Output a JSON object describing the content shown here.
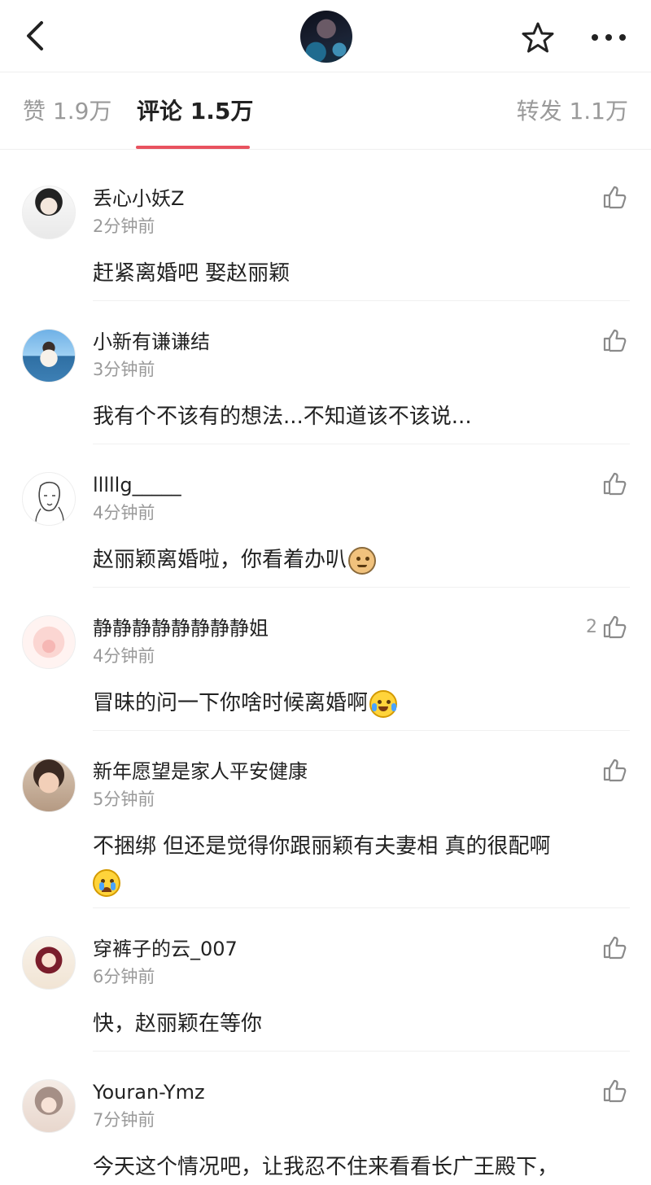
{
  "header": {
    "back_icon": "chevron-left-icon",
    "star_icon": "star-icon",
    "more_icon": "more-dots-icon"
  },
  "tabs": [
    {
      "label": "赞 1.9万"
    },
    {
      "label": "评论 1.5万"
    },
    {
      "label": "转发 1.1万"
    }
  ],
  "colors": {
    "accent": "#e8525f",
    "muted": "#9a9a9a",
    "text": "#222222"
  },
  "comments": [
    {
      "username": "丢心小妖Z",
      "time": "2分钟前",
      "text": "赶紧离婚吧 娶赵丽颖",
      "likes": "",
      "emoji": ""
    },
    {
      "username": "小新有谦谦结",
      "time": "3分钟前",
      "text": "我有个不该有的想法...不知道该不该说...",
      "likes": "",
      "emoji": ""
    },
    {
      "username": "lllllg_____",
      "time": "4分钟前",
      "text": "赵丽颖离婚啦，你看着办叭",
      "likes": "",
      "emoji": "cat-emoji"
    },
    {
      "username": "静静静静静静静静姐",
      "time": "4分钟前",
      "text": "冒昧的问一下你啥时候离婚啊",
      "likes": "2",
      "emoji": "laughing-crying-emoji"
    },
    {
      "username": "新年愿望是家人平安健康",
      "time": "5分钟前",
      "text": "不捆绑 但还是觉得你跟丽颖有夫妻相 真的很配啊",
      "likes": "",
      "emoji": "crying-emoji"
    },
    {
      "username": "穿裤子的云_007",
      "time": "6分钟前",
      "text": "快，赵丽颖在等你",
      "likes": "",
      "emoji": ""
    },
    {
      "username": "Youran-Ymz",
      "time": "7分钟前",
      "text": "今天这个情况吧，让我忍不住来看看长广王殿下，",
      "likes": "",
      "emoji": ""
    }
  ]
}
